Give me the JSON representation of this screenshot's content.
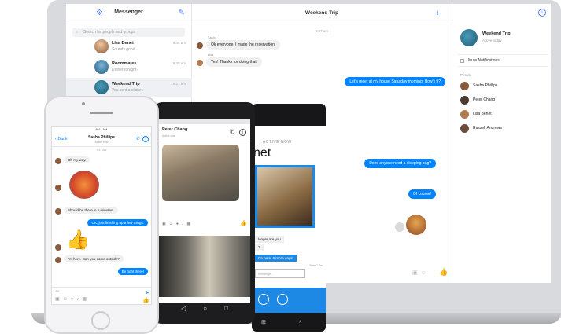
{
  "laptop": {
    "left_pane": {
      "title": "Messenger",
      "search_placeholder": "Search for people and groups",
      "conversations": [
        {
          "name": "Lisa Benet",
          "snippet": "Sounds good",
          "time": "9:45 am"
        },
        {
          "name": "Roommates",
          "snippet": "Dinner tonight?",
          "time": "9:30 am"
        },
        {
          "name": "Weekend Trip",
          "snippet": "You sent a sticker.",
          "time": "8:27 am"
        }
      ]
    },
    "center_pane": {
      "title": "Weekend Trip",
      "timestamp": "8:27 am",
      "messages": [
        {
          "sender": "Sasha",
          "text": "Ok everyone, I made the reservation!",
          "dir": "in"
        },
        {
          "sender": "Lisa",
          "text": "Yes! Thanks for doing that.",
          "dir": "in"
        },
        {
          "text": "Let's meet at my house Saturday morning. How's 9?",
          "dir": "out"
        },
        {
          "text": "Does anyone need a sleeping bag?",
          "dir": "out"
        },
        {
          "text": "Of course!",
          "dir": "out"
        }
      ]
    },
    "right_pane": {
      "group_name": "Weekend Trip",
      "group_status": "Active today",
      "mute_label": "Mute Notifications",
      "people_label": "People",
      "people": [
        "Sasha Phillips",
        "Peter Chang",
        "Lisa Benet",
        "Russell Andrews"
      ]
    }
  },
  "iphone": {
    "status": "9:41 AM",
    "back_label": "Back",
    "contact_name": "Sasha Phillips",
    "contact_status": "Active now",
    "timestamp": "9:41 AM",
    "messages": [
      {
        "text": "Oh my way.",
        "dir": "in"
      },
      {
        "text": "Should be there in 5 minutes.",
        "dir": "in"
      },
      {
        "text": "OK, just finishing up a few things.",
        "dir": "out"
      },
      {
        "text": "I'm here. Can you come outside?",
        "dir": "in"
      },
      {
        "text": "Be right there!",
        "dir": "out"
      }
    ],
    "input_placeholder": "Aa"
  },
  "android": {
    "contact_name": "Peter Chang",
    "contact_status": "Active now"
  },
  "winphone": {
    "header_small": "ACTIVE NOW",
    "header_large": "net",
    "messages": [
      {
        "text": "longer are you",
        "dir": "in"
      },
      {
        "text": "?",
        "dir": "in"
      },
      {
        "text": "I'm here, 5 more days!",
        "dir": "out"
      }
    ],
    "seen": "Seen 1:7m",
    "input_placeholder": "message..."
  },
  "colors": {
    "accent": "#0084ff",
    "incoming": "#f1f0f0"
  }
}
